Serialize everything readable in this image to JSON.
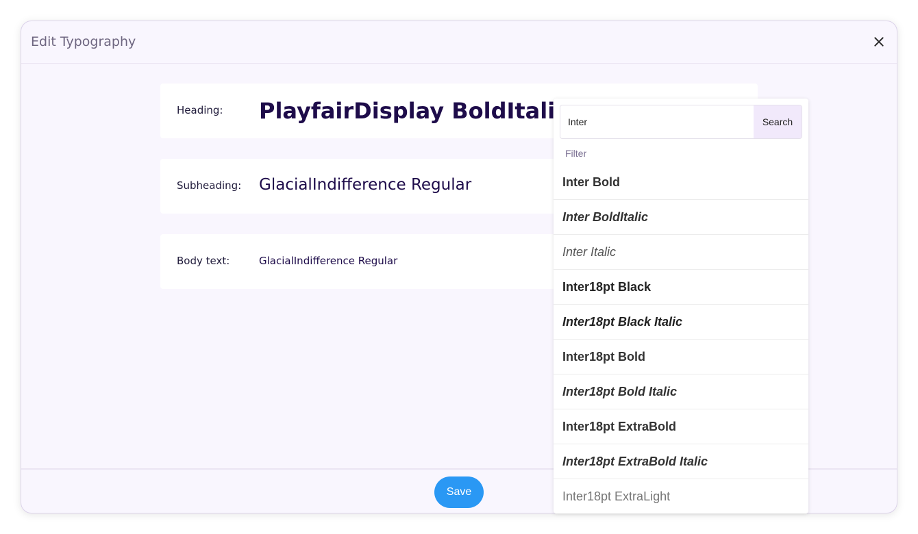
{
  "modal": {
    "title": "Edit Typography",
    "save_label": "Save"
  },
  "rows": {
    "heading": {
      "label": "Heading:",
      "value": "PlayfairDisplay BoldItalic"
    },
    "subheading": {
      "label": "Subheading:",
      "value": "GlacialIndifference Regular"
    },
    "body": {
      "label": "Body text:",
      "value": "GlacialIndifference Regular"
    }
  },
  "dropdown": {
    "search_value": "Inter",
    "search_button": "Search",
    "filter_label": "Filter",
    "fonts": [
      "Inter Bold",
      "Inter BoldItalic",
      "Inter Italic",
      "Inter18pt Black",
      "Inter18pt Black Italic",
      "Inter18pt Bold",
      "Inter18pt Bold Italic",
      "Inter18pt ExtraBold",
      "Inter18pt ExtraBold Italic",
      "Inter18pt ExtraLight"
    ]
  },
  "colors": {
    "accent": "#2a98f4",
    "text_dark": "#1e0c4a",
    "search_button_bg": "#f1e9fb"
  }
}
